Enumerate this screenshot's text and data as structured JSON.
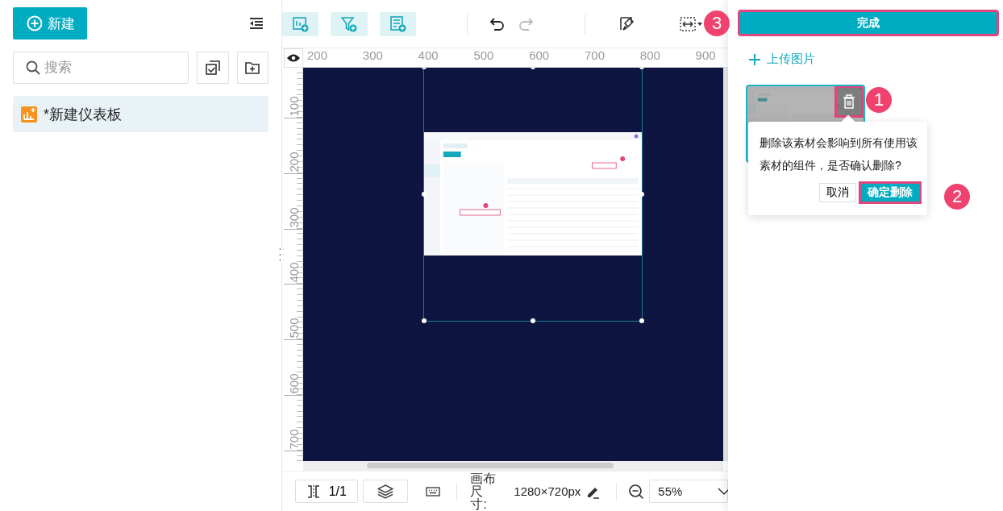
{
  "sidebar": {
    "new_button": "新建",
    "search": {
      "placeholder": "搜索"
    },
    "items": [
      {
        "label": "*新建仪表板",
        "selected": true
      }
    ]
  },
  "toolbar": {
    "undo": {
      "disabled": false
    },
    "redo": {
      "disabled": true
    }
  },
  "ruler": {
    "x_labels": [
      "200",
      "300",
      "400",
      "500",
      "600",
      "700",
      "800",
      "900"
    ],
    "y_labels": [
      "100",
      "200",
      "300",
      "400",
      "500",
      "600",
      "700"
    ]
  },
  "footer": {
    "page": "1/1",
    "size_label": "画布尺寸:",
    "size": "1280×720px",
    "zoom": "55%"
  },
  "panel": {
    "done_button": {
      "label": "完成",
      "highlighted": true
    },
    "upload_link": "上传图片",
    "delete_highlighted": true,
    "popconfirm": {
      "message": "删除该素材会影响到所有使用该素材的组件，是否确认删除?",
      "cancel": "取消",
      "confirm": {
        "label": "确定删除",
        "highlighted": true
      }
    }
  },
  "callouts": [
    {
      "number": "1"
    },
    {
      "number": "2"
    },
    {
      "number": "3"
    }
  ]
}
